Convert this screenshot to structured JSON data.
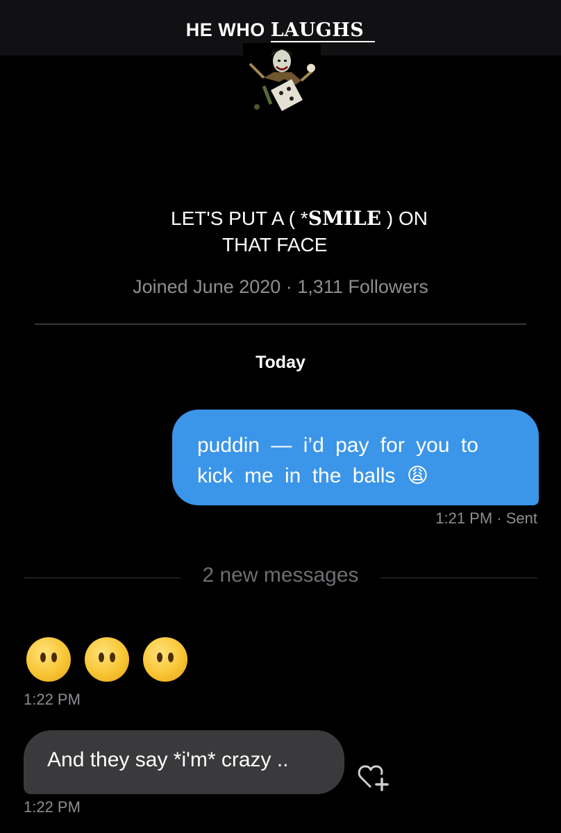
{
  "header": {
    "title_part1": "HE WHO",
    "title_part2": "LAUGHS",
    "avatar_icon": "joker-avatar-icon"
  },
  "profile": {
    "bio_line1_a": "LET'S PUT A  ( *",
    "bio_line1_b": "SMILE",
    "bio_line1_c": " )  ON",
    "bio_line2": "THAT FACE",
    "meta": "Joined June 2020 · 1,311 Followers"
  },
  "conversation": {
    "day_label": "Today",
    "outgoing": {
      "line1": "puddin — i’d pay for you to",
      "line2": "kick me in the balls",
      "emoji": "😩",
      "time": "1:21 PM",
      "status": "· Sent"
    },
    "separator": "2 new messages",
    "incoming_emoji": {
      "faces": [
        "face-without-mouth-icon",
        "face-without-mouth-icon",
        "face-without-mouth-icon"
      ],
      "time": "1:22 PM"
    },
    "incoming_text": {
      "text": "And they say *i'm* crazy ..",
      "time": "1:22 PM",
      "react_icon": "add-reaction-heart-icon"
    }
  },
  "colors": {
    "background": "#000000",
    "outgoing_bubble": "#3b95e8",
    "incoming_bubble": "#3a3a3c",
    "muted_text": "#8e8e93"
  }
}
